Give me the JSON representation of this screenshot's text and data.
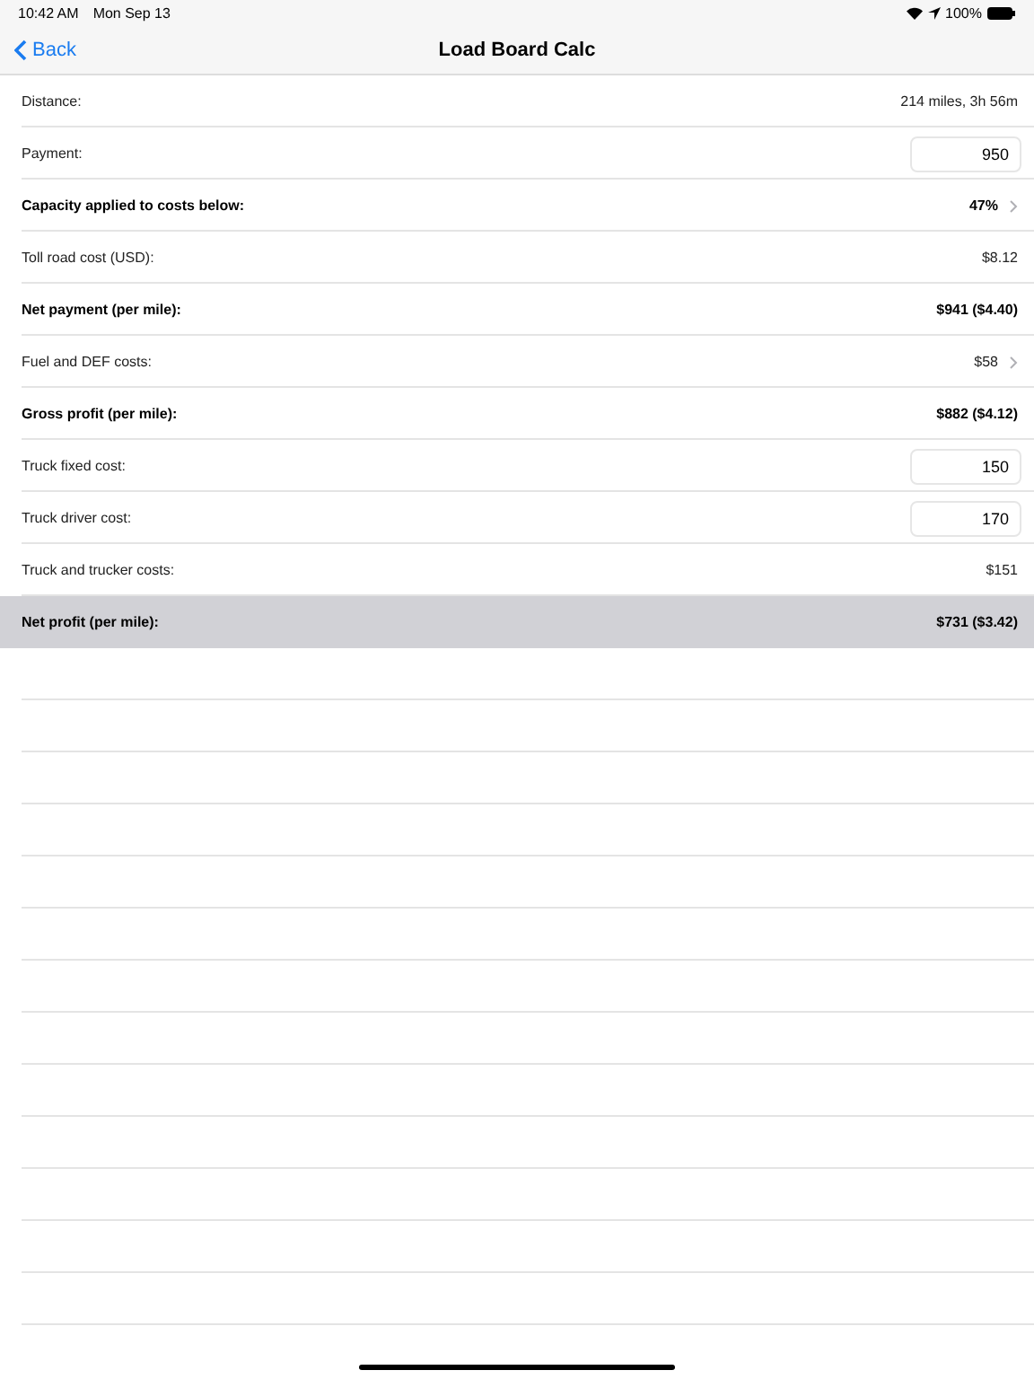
{
  "status_bar": {
    "time": "10:42 AM",
    "date": "Mon Sep 13",
    "battery": "100%"
  },
  "nav": {
    "back": "Back",
    "title": "Load Board Calc"
  },
  "rows": [
    {
      "kind": "text",
      "label": "Distance:",
      "value": "214 miles, 3h 56m",
      "bold": false,
      "highlighted": false
    },
    {
      "kind": "input",
      "label": "Payment:",
      "value": "950",
      "bold": false,
      "highlighted": false
    },
    {
      "kind": "disclosure",
      "label": "Capacity applied to costs below:",
      "value": "47%",
      "bold": true,
      "highlighted": false
    },
    {
      "kind": "text",
      "label": "Toll road cost (USD):",
      "value": "$8.12",
      "bold": false,
      "highlighted": false
    },
    {
      "kind": "text",
      "label": "Net payment (per mile):",
      "value": "$941 ($4.40)",
      "bold": true,
      "highlighted": false
    },
    {
      "kind": "disclosure",
      "label": "Fuel and DEF costs:",
      "value": "$58",
      "bold": false,
      "highlighted": false
    },
    {
      "kind": "text",
      "label": "Gross profit (per mile):",
      "value": "$882 ($4.12)",
      "bold": true,
      "highlighted": false
    },
    {
      "kind": "input",
      "label": "Truck fixed cost:",
      "value": "150",
      "bold": false,
      "highlighted": false
    },
    {
      "kind": "input",
      "label": "Truck driver cost:",
      "value": "170",
      "bold": false,
      "highlighted": false
    },
    {
      "kind": "text",
      "label": "Truck and trucker costs:",
      "value": "$151",
      "bold": false,
      "highlighted": false
    },
    {
      "kind": "text",
      "label": "Net profit (per mile):",
      "value": "$731 ($3.42)",
      "bold": true,
      "highlighted": true
    }
  ]
}
